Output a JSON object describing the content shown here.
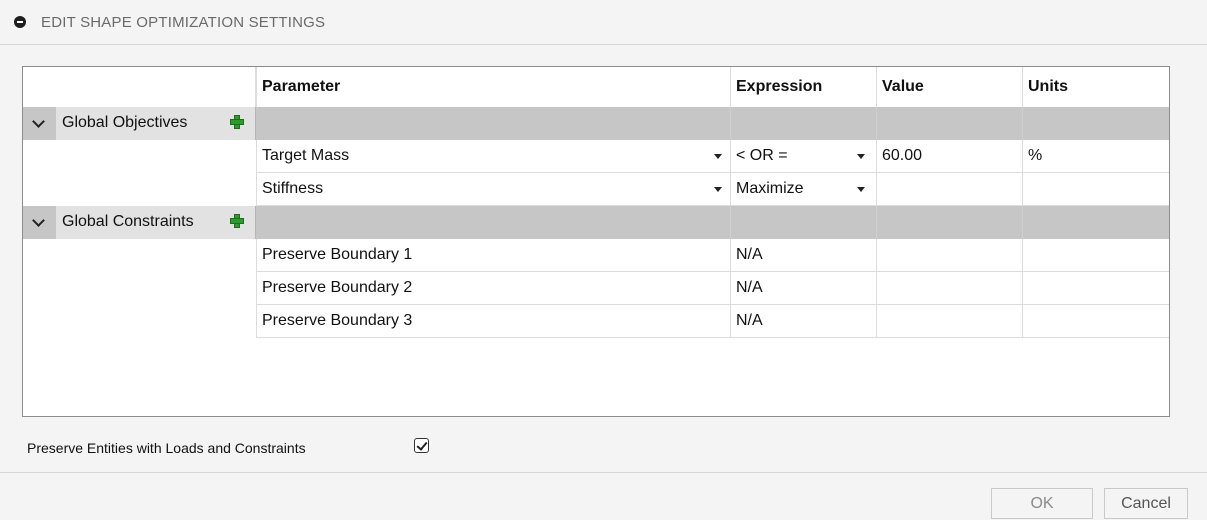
{
  "header": {
    "title": "EDIT SHAPE OPTIMIZATION SETTINGS"
  },
  "table": {
    "columns": [
      "Parameter",
      "Expression",
      "Value",
      "Units"
    ],
    "groups": [
      {
        "label": "Global Objectives",
        "rows": [
          {
            "parameter": "Target Mass",
            "expression": "< OR =",
            "value": "60.00",
            "units": "%"
          },
          {
            "parameter": "Stiffness",
            "expression": "Maximize",
            "value": "",
            "units": ""
          }
        ]
      },
      {
        "label": "Global Constraints",
        "rows": [
          {
            "parameter": "Preserve Boundary 1",
            "expression": "N/A",
            "value": "",
            "units": ""
          },
          {
            "parameter": "Preserve Boundary 2",
            "expression": "N/A",
            "value": "",
            "units": ""
          },
          {
            "parameter": "Preserve Boundary 3",
            "expression": "N/A",
            "value": "",
            "units": ""
          }
        ]
      }
    ]
  },
  "options": {
    "preserve_entities_label": "Preserve Entities with Loads and Constraints",
    "preserve_entities_checked": true
  },
  "buttons": {
    "ok": "OK",
    "cancel": "Cancel"
  }
}
